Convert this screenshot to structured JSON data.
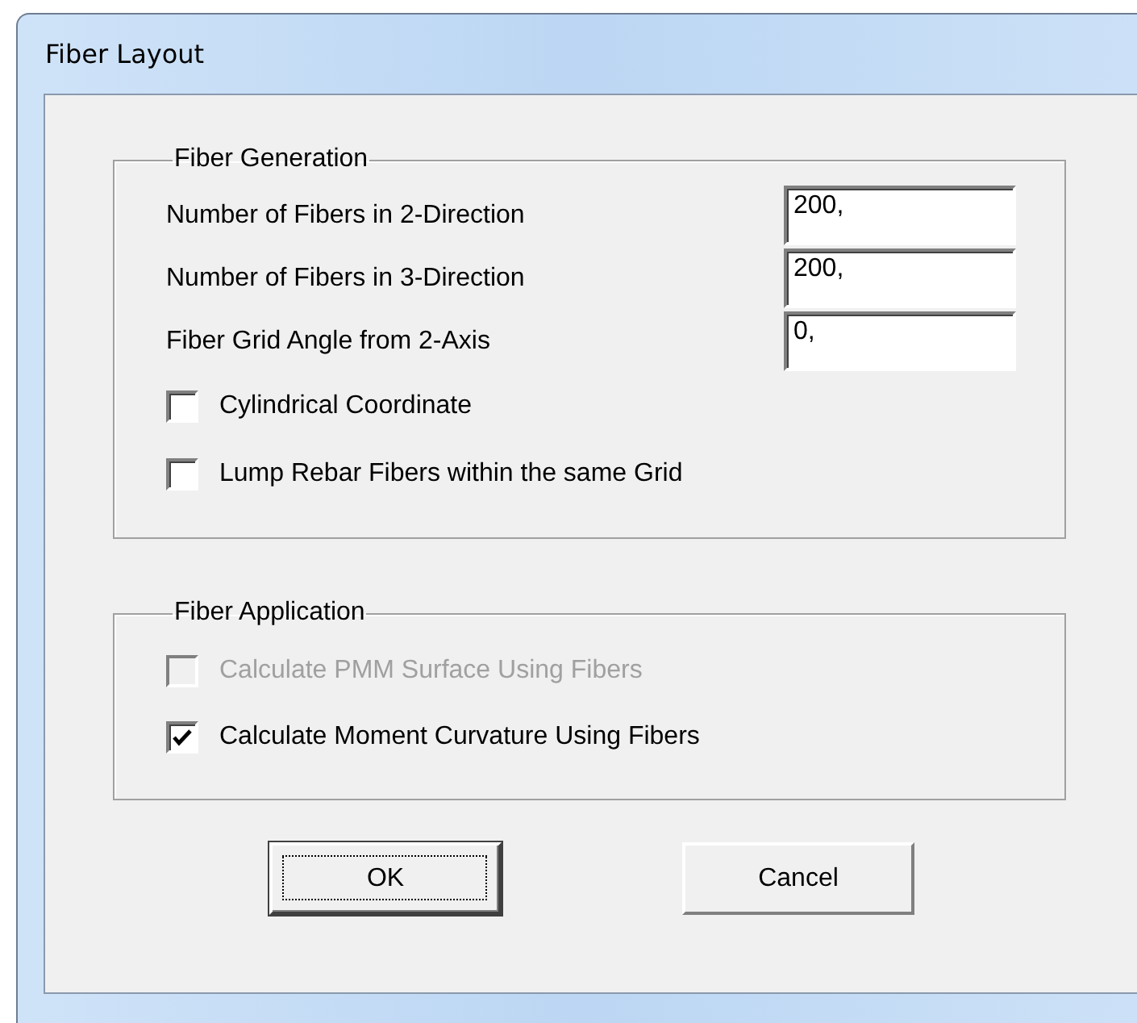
{
  "window": {
    "title": "Fiber Layout"
  },
  "groups": [
    {
      "title": "Fiber Generation",
      "rows": [
        {
          "kind": "field",
          "label": "Number of Fibers in 2-Direction",
          "value": "200,"
        },
        {
          "kind": "field",
          "label": "Number of Fibers in 3-Direction",
          "value": "200,"
        },
        {
          "kind": "field",
          "label": "Fiber Grid Angle from 2-Axis",
          "value": "0,"
        },
        {
          "kind": "checkbox",
          "label": "Cylindrical Coordinate",
          "checked": false,
          "disabled": false
        },
        {
          "kind": "checkbox",
          "label": "Lump Rebar Fibers within the same Grid",
          "checked": false,
          "disabled": false
        }
      ]
    },
    {
      "title": "Fiber Application",
      "rows": [
        {
          "kind": "checkbox",
          "label": "Calculate PMM Surface Using Fibers",
          "checked": false,
          "disabled": true
        },
        {
          "kind": "checkbox",
          "label": "Calculate Moment Curvature Using Fibers",
          "checked": true,
          "disabled": false
        }
      ]
    }
  ],
  "buttons": [
    {
      "label": "OK",
      "default": true
    },
    {
      "label": "Cancel",
      "default": false
    }
  ]
}
